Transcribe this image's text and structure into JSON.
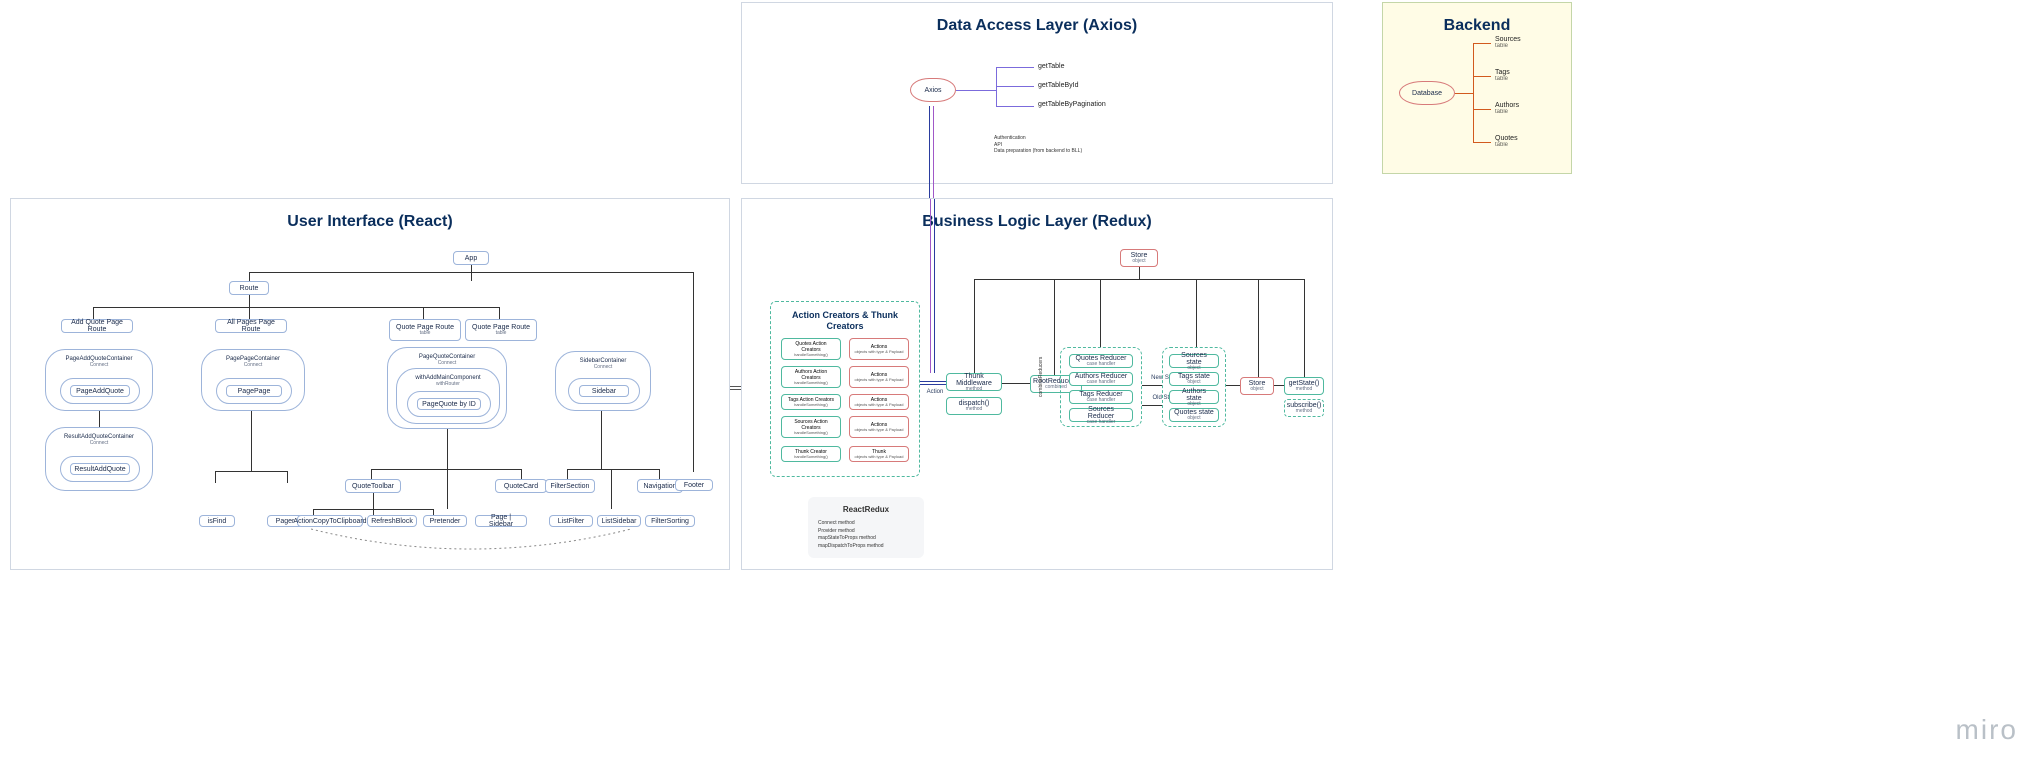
{
  "brand": "miro",
  "panels": {
    "ui": {
      "title": "User Interface (React)"
    },
    "dal": {
      "title": "Data Access Layer (Axios)"
    },
    "bll": {
      "title": "Business Logic Layer (Redux)"
    },
    "backend": {
      "title": "Backend"
    }
  },
  "ui_nodes": {
    "app": "App",
    "route": "Route",
    "pages": {
      "addQuote": "Add Quote Page Route",
      "allPages": "All Pages Page Route",
      "quotePage": "Quote Page Route",
      "quotePage2": "Quote Page Route"
    },
    "containers": {
      "pageAddQuote": {
        "title": "PageAddQuoteContainer",
        "sub": "Connect"
      },
      "pagePage": {
        "title": "PagePageContainer",
        "sub": "Connect"
      },
      "pageQuote": {
        "title": "PageQuoteContainer",
        "sub": "Connect",
        "withRouter": "withRouter",
        "childA": "withAddMainComponent",
        "childB": "PageQuote by ID"
      },
      "sidebar": {
        "title": "SidebarContainer",
        "sub": "Connect",
        "child": "Sidebar"
      },
      "resultAdd": {
        "title": "ResultAddQuoteContainer",
        "sub": "Connect",
        "child": "ResultAddQuote"
      }
    },
    "children": {
      "pageAddQuoteChild": "PageAddQuote",
      "pagePageChild": "PagePage",
      "tableRouteA": "table",
      "tableRouteB": "table"
    },
    "bottomRow": [
      "isFind",
      "Pager",
      "QuoteToolbar",
      "ActionCopyToClipboard",
      "RefreshBlock",
      "Pretender",
      "QuoteCard",
      "Page | Sidebar",
      "FilterSection",
      "ListFilter",
      "ListSidebar",
      "FilterSorting",
      "Navigation",
      "Footer"
    ]
  },
  "dal": {
    "axios": "Axios",
    "methods": [
      "getTable",
      "getTableById",
      "getTableByPagination"
    ],
    "notes": [
      "Authentication",
      "API",
      "Data preparation (from backend to BLL)"
    ]
  },
  "bll": {
    "action_creators_title": "Action Creators & Thunk Creators",
    "rows": [
      {
        "left": {
          "t": "Quotes Action Creators",
          "s": "handleSomething()"
        },
        "right": {
          "t": "Actions",
          "s": "objects with type & Payload"
        }
      },
      {
        "left": {
          "t": "Authors Action Creators",
          "s": "handleSomething()"
        },
        "right": {
          "t": "Actions",
          "s": "objects with type & Payload"
        }
      },
      {
        "left": {
          "t": "Tags Action Creators",
          "s": "handleSomething()"
        },
        "right": {
          "t": "Actions",
          "s": "objects with type & Payload"
        }
      },
      {
        "left": {
          "t": "Sources Action Creators",
          "s": "handleSomething()"
        },
        "right": {
          "t": "Actions",
          "s": "objects with type & Payload"
        }
      },
      {
        "left": {
          "t": "Thunk Creator",
          "s": "handleSomething()"
        },
        "right": {
          "t": "Thunk",
          "s": "objects with type & Payload"
        }
      }
    ],
    "flow": {
      "thunkMiddleware": {
        "t": "Thunk Middleware",
        "s": "method"
      },
      "dispatch": {
        "t": "dispatch()",
        "s": "method"
      },
      "rootReducer": {
        "t": "RootReducer()",
        "s": "combined"
      },
      "reducers": [
        "Quotes Reducer",
        "Authors Reducer",
        "Tags Reducer",
        "Sources Reducer"
      ],
      "reducerSub": "case handler",
      "stateLabels": [
        "Sources state",
        "Tags state",
        "Authors state",
        "Quotes state"
      ],
      "stateSub": "object",
      "store": {
        "t": "Store",
        "s": "object"
      },
      "getState": {
        "t": "getState()",
        "s": "method"
      },
      "subscribe": {
        "t": "subscribe()",
        "s": "method"
      },
      "newstate": "New State",
      "oldstate": "Old State",
      "actionlbl": "Action"
    },
    "react_redux": {
      "title": "ReactRedux",
      "items": [
        "Connect method",
        "Provider method",
        "mapStateToProps method",
        "mapDispatchToProps method"
      ]
    }
  },
  "backend": {
    "db": "Database",
    "tables": [
      {
        "name": "Sources",
        "sub": "table"
      },
      {
        "name": "Tags",
        "sub": "table"
      },
      {
        "name": "Authors",
        "sub": "table"
      },
      {
        "name": "Quotes",
        "sub": "table"
      }
    ]
  }
}
